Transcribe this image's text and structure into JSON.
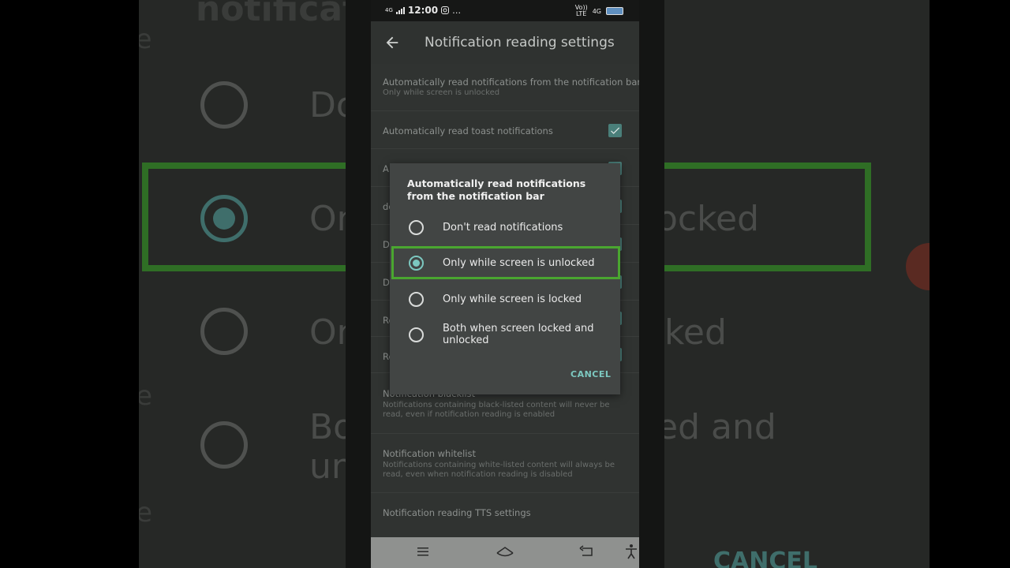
{
  "statusbar": {
    "time": "12:00",
    "net": "4G",
    "volte": "Vo))",
    "lte": "LTE",
    "net2": "4G",
    "dots": "…"
  },
  "appbar": {
    "title": "Notification reading settings",
    "back_icon": "arrow-left-icon"
  },
  "settings": [
    {
      "title": "Automatically read notifications from the notification bar",
      "subtitle": "Only while screen is unlocked"
    },
    {
      "title": "Automatically read toast notifications",
      "checked": true
    },
    {
      "title": "A",
      "checked": true
    },
    {
      "title": "de"
    },
    {
      "title": "D"
    },
    {
      "title": "D"
    },
    {
      "title": "Re"
    },
    {
      "title": "Re"
    },
    {
      "title": "Notification blacklist",
      "subtitle": "Notifications containing black-listed content will never be read, even if notification reading is enabled"
    },
    {
      "title": "Notification whitelist",
      "subtitle": "Notifications containing white-listed content will always be read, even when notification reading is disabled"
    },
    {
      "title": "Notification reading TTS settings"
    }
  ],
  "dialog": {
    "title": "Automatically read notifications from the notification bar",
    "options": [
      {
        "label": "Don't read notifications",
        "selected": false
      },
      {
        "label": "Only while screen is unlocked",
        "selected": true
      },
      {
        "label": "Only while screen is locked",
        "selected": false
      },
      {
        "label": "Both when screen locked and unlocked",
        "selected": false
      }
    ],
    "cancel_label": "CANCEL"
  },
  "background": {
    "left_texts": [
      "notificatio",
      "de",
      "Do",
      "D",
      "On",
      "D",
      "On",
      "Re",
      "Bo",
      "un",
      "Re"
    ],
    "right_texts": [
      "ocked",
      "ked",
      "ed and",
      "CANCEL"
    ]
  },
  "navbar": {
    "icons": [
      "menu-icon",
      "home-icon",
      "back-icon",
      "accessibility-icon"
    ]
  },
  "colors": {
    "accent": "#7cc8c0",
    "highlight": "#4aa630",
    "dialog_bg": "#424544",
    "screen_bg": "#303331"
  }
}
